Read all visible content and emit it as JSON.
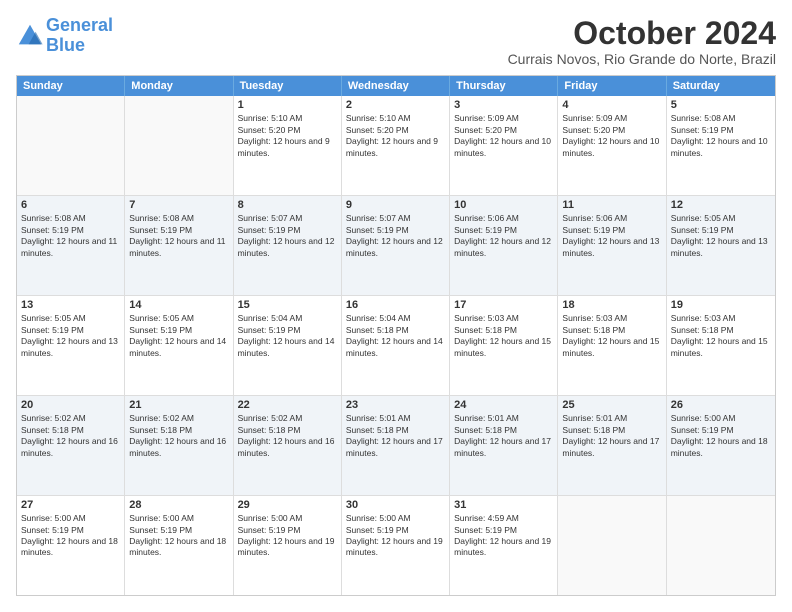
{
  "logo": {
    "line1": "General",
    "line2": "Blue"
  },
  "title": "October 2024",
  "location": "Currais Novos, Rio Grande do Norte, Brazil",
  "dayHeaders": [
    "Sunday",
    "Monday",
    "Tuesday",
    "Wednesday",
    "Thursday",
    "Friday",
    "Saturday"
  ],
  "weeks": [
    [
      {
        "day": "",
        "info": ""
      },
      {
        "day": "",
        "info": ""
      },
      {
        "day": "1",
        "info": "Sunrise: 5:10 AM\nSunset: 5:20 PM\nDaylight: 12 hours and 9 minutes."
      },
      {
        "day": "2",
        "info": "Sunrise: 5:10 AM\nSunset: 5:20 PM\nDaylight: 12 hours and 9 minutes."
      },
      {
        "day": "3",
        "info": "Sunrise: 5:09 AM\nSunset: 5:20 PM\nDaylight: 12 hours and 10 minutes."
      },
      {
        "day": "4",
        "info": "Sunrise: 5:09 AM\nSunset: 5:20 PM\nDaylight: 12 hours and 10 minutes."
      },
      {
        "day": "5",
        "info": "Sunrise: 5:08 AM\nSunset: 5:19 PM\nDaylight: 12 hours and 10 minutes."
      }
    ],
    [
      {
        "day": "6",
        "info": "Sunrise: 5:08 AM\nSunset: 5:19 PM\nDaylight: 12 hours and 11 minutes."
      },
      {
        "day": "7",
        "info": "Sunrise: 5:08 AM\nSunset: 5:19 PM\nDaylight: 12 hours and 11 minutes."
      },
      {
        "day": "8",
        "info": "Sunrise: 5:07 AM\nSunset: 5:19 PM\nDaylight: 12 hours and 12 minutes."
      },
      {
        "day": "9",
        "info": "Sunrise: 5:07 AM\nSunset: 5:19 PM\nDaylight: 12 hours and 12 minutes."
      },
      {
        "day": "10",
        "info": "Sunrise: 5:06 AM\nSunset: 5:19 PM\nDaylight: 12 hours and 12 minutes."
      },
      {
        "day": "11",
        "info": "Sunrise: 5:06 AM\nSunset: 5:19 PM\nDaylight: 12 hours and 13 minutes."
      },
      {
        "day": "12",
        "info": "Sunrise: 5:05 AM\nSunset: 5:19 PM\nDaylight: 12 hours and 13 minutes."
      }
    ],
    [
      {
        "day": "13",
        "info": "Sunrise: 5:05 AM\nSunset: 5:19 PM\nDaylight: 12 hours and 13 minutes."
      },
      {
        "day": "14",
        "info": "Sunrise: 5:05 AM\nSunset: 5:19 PM\nDaylight: 12 hours and 14 minutes."
      },
      {
        "day": "15",
        "info": "Sunrise: 5:04 AM\nSunset: 5:19 PM\nDaylight: 12 hours and 14 minutes."
      },
      {
        "day": "16",
        "info": "Sunrise: 5:04 AM\nSunset: 5:18 PM\nDaylight: 12 hours and 14 minutes."
      },
      {
        "day": "17",
        "info": "Sunrise: 5:03 AM\nSunset: 5:18 PM\nDaylight: 12 hours and 15 minutes."
      },
      {
        "day": "18",
        "info": "Sunrise: 5:03 AM\nSunset: 5:18 PM\nDaylight: 12 hours and 15 minutes."
      },
      {
        "day": "19",
        "info": "Sunrise: 5:03 AM\nSunset: 5:18 PM\nDaylight: 12 hours and 15 minutes."
      }
    ],
    [
      {
        "day": "20",
        "info": "Sunrise: 5:02 AM\nSunset: 5:18 PM\nDaylight: 12 hours and 16 minutes."
      },
      {
        "day": "21",
        "info": "Sunrise: 5:02 AM\nSunset: 5:18 PM\nDaylight: 12 hours and 16 minutes."
      },
      {
        "day": "22",
        "info": "Sunrise: 5:02 AM\nSunset: 5:18 PM\nDaylight: 12 hours and 16 minutes."
      },
      {
        "day": "23",
        "info": "Sunrise: 5:01 AM\nSunset: 5:18 PM\nDaylight: 12 hours and 17 minutes."
      },
      {
        "day": "24",
        "info": "Sunrise: 5:01 AM\nSunset: 5:18 PM\nDaylight: 12 hours and 17 minutes."
      },
      {
        "day": "25",
        "info": "Sunrise: 5:01 AM\nSunset: 5:18 PM\nDaylight: 12 hours and 17 minutes."
      },
      {
        "day": "26",
        "info": "Sunrise: 5:00 AM\nSunset: 5:19 PM\nDaylight: 12 hours and 18 minutes."
      }
    ],
    [
      {
        "day": "27",
        "info": "Sunrise: 5:00 AM\nSunset: 5:19 PM\nDaylight: 12 hours and 18 minutes."
      },
      {
        "day": "28",
        "info": "Sunrise: 5:00 AM\nSunset: 5:19 PM\nDaylight: 12 hours and 18 minutes."
      },
      {
        "day": "29",
        "info": "Sunrise: 5:00 AM\nSunset: 5:19 PM\nDaylight: 12 hours and 19 minutes."
      },
      {
        "day": "30",
        "info": "Sunrise: 5:00 AM\nSunset: 5:19 PM\nDaylight: 12 hours and 19 minutes."
      },
      {
        "day": "31",
        "info": "Sunrise: 4:59 AM\nSunset: 5:19 PM\nDaylight: 12 hours and 19 minutes."
      },
      {
        "day": "",
        "info": ""
      },
      {
        "day": "",
        "info": ""
      }
    ]
  ]
}
